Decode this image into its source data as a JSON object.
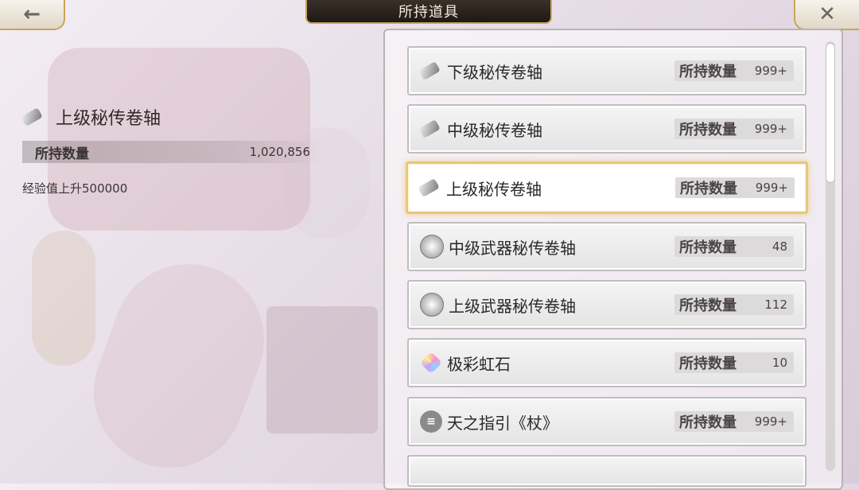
{
  "header": {
    "title": "所持道具",
    "back_glyph": "←",
    "close_glyph": "✕"
  },
  "detail": {
    "name": "上级秘传卷轴",
    "icon": "scroll-icon",
    "qty_label": "所持数量",
    "qty_value": "1,020,856",
    "description": "经验值上升500000"
  },
  "items": [
    {
      "name": "下级秘传卷轴",
      "icon": "scroll-icon",
      "qty_label": "所持数量",
      "qty": "999+"
    },
    {
      "name": "中级秘传卷轴",
      "icon": "scroll-icon",
      "qty_label": "所持数量",
      "qty": "999+"
    },
    {
      "name": "上级秘传卷轴",
      "icon": "scroll-icon",
      "qty_label": "所持数量",
      "qty": "999+",
      "selected": true
    },
    {
      "name": "中级武器秘传卷轴",
      "icon": "weapon-scroll-icon",
      "qty_label": "所持数量",
      "qty": "48"
    },
    {
      "name": "上级武器秘传卷轴",
      "icon": "weapon-scroll-icon",
      "qty_label": "所持数量",
      "qty": "112"
    },
    {
      "name": "极彩虹石",
      "icon": "rainbow-gem-icon",
      "qty_label": "所持数量",
      "qty": "10"
    },
    {
      "name": "天之指引《杖》",
      "icon": "guide-staff-icon",
      "qty_label": "所持数量",
      "qty": "999+"
    }
  ],
  "colors": {
    "accent_gold": "#c9a45a",
    "selected_border": "#e9c77a"
  }
}
